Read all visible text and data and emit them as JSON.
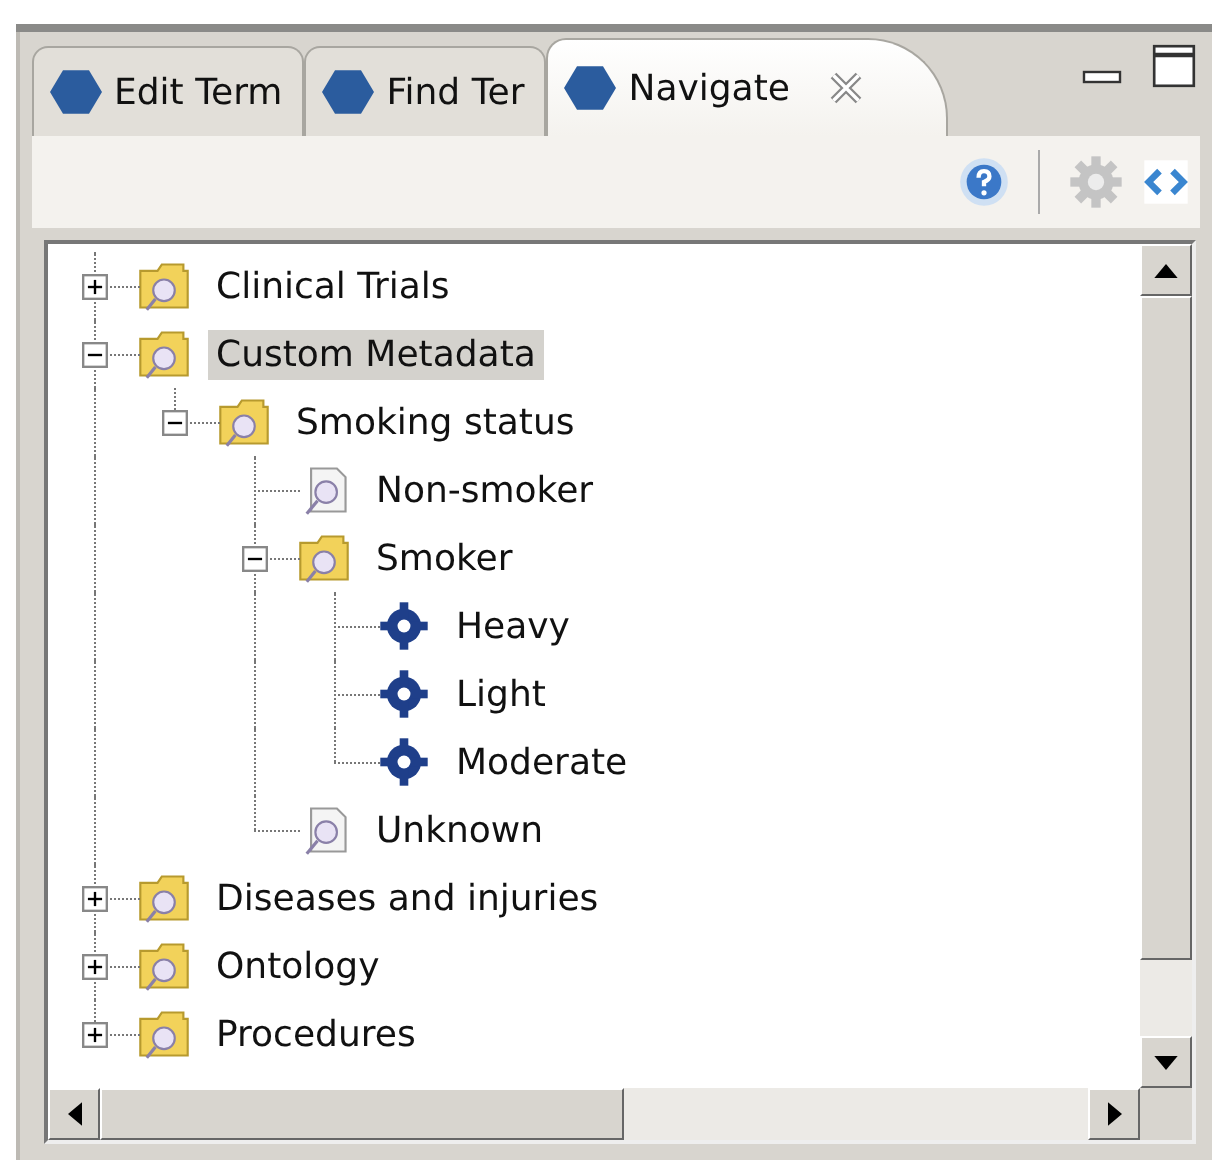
{
  "tabs": [
    {
      "label": "Edit Term",
      "selected": false,
      "closable": false
    },
    {
      "label": "Find Ter",
      "selected": false,
      "closable": false
    },
    {
      "label": "Navigate",
      "selected": true,
      "closable": true
    }
  ],
  "tree": [
    {
      "label": "Clinical Trials",
      "kind": "folder",
      "expanded": false,
      "selected": false
    },
    {
      "label": "Custom Metadata",
      "kind": "folder",
      "expanded": true,
      "selected": true,
      "children": [
        {
          "label": "Smoking status",
          "kind": "folder",
          "expanded": true,
          "selected": false,
          "children": [
            {
              "label": "Non-smoker",
              "kind": "term",
              "selected": false
            },
            {
              "label": "Smoker",
              "kind": "folder",
              "expanded": true,
              "selected": false,
              "children": [
                {
                  "label": "Heavy",
                  "kind": "concept",
                  "selected": false
                },
                {
                  "label": "Light",
                  "kind": "concept",
                  "selected": false
                },
                {
                  "label": "Moderate",
                  "kind": "concept",
                  "selected": false
                }
              ]
            },
            {
              "label": "Unknown",
              "kind": "term",
              "selected": false
            }
          ]
        }
      ]
    },
    {
      "label": "Diseases and injuries",
      "kind": "folder",
      "expanded": false,
      "selected": false
    },
    {
      "label": "Ontology",
      "kind": "folder",
      "expanded": false,
      "selected": false
    },
    {
      "label": "Procedures",
      "kind": "folder",
      "expanded": false,
      "selected": false
    }
  ]
}
